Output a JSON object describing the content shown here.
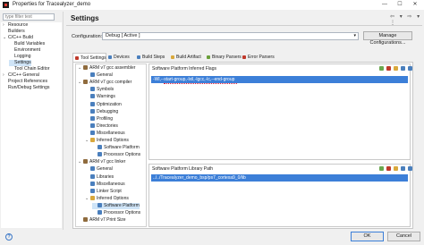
{
  "window": {
    "title": "Properties for Tracealyzer_demo",
    "controls": [
      "—",
      "☐",
      "✕"
    ]
  },
  "left": {
    "filter_placeholder": "type filter text",
    "tree": [
      {
        "label": "Resource",
        "twisty": "›",
        "depth": 0
      },
      {
        "label": "Builders",
        "twisty": "",
        "depth": 0
      },
      {
        "label": "C/C++ Build",
        "twisty": "⌄",
        "depth": 0
      },
      {
        "label": "Build Variables",
        "twisty": "",
        "depth": 1
      },
      {
        "label": "Environment",
        "twisty": "",
        "depth": 1
      },
      {
        "label": "Logging",
        "twisty": "",
        "depth": 1
      },
      {
        "label": "Settings",
        "twisty": "",
        "depth": 1,
        "selected": true
      },
      {
        "label": "Tool Chain Editor",
        "twisty": "",
        "depth": 1
      },
      {
        "label": "C/C++ General",
        "twisty": "›",
        "depth": 0
      },
      {
        "label": "Project References",
        "twisty": "",
        "depth": 0
      },
      {
        "label": "Run/Debug Settings",
        "twisty": "",
        "depth": 0
      }
    ]
  },
  "header": {
    "title": "Settings",
    "nav_icons": [
      "⇦",
      "▾",
      "⇨",
      "▾",
      "⋮"
    ]
  },
  "config": {
    "label": "Configuration:",
    "value": "Debug [ Active ]",
    "manage_label": "Manage Configurations..."
  },
  "tabs": [
    {
      "label": "Tool Settings",
      "active": true,
      "color": "#c0392b"
    },
    {
      "label": "Devices",
      "color": "#4a7fbd"
    },
    {
      "label": "Build Steps",
      "color": "#4a7fbd"
    },
    {
      "label": "Build Artifact",
      "color": "#d9a83c"
    },
    {
      "label": "Binary Parsers",
      "color": "#6a9f3a"
    },
    {
      "label": "Error Parsers",
      "color": "#c0392b"
    }
  ],
  "tool_tree": [
    {
      "label": "ARM v7 gcc assembler",
      "twisty": "⌄",
      "icon": "tool",
      "depth": 0
    },
    {
      "label": "General",
      "twisty": "",
      "icon": "opt",
      "depth": 1
    },
    {
      "label": "ARM v7 gcc compiler",
      "twisty": "⌄",
      "icon": "tool",
      "depth": 0
    },
    {
      "label": "Symbols",
      "twisty": "",
      "icon": "opt",
      "depth": 1
    },
    {
      "label": "Warnings",
      "twisty": "",
      "icon": "opt",
      "depth": 1
    },
    {
      "label": "Optimization",
      "twisty": "",
      "icon": "opt",
      "depth": 1
    },
    {
      "label": "Debugging",
      "twisty": "",
      "icon": "opt",
      "depth": 1
    },
    {
      "label": "Profiling",
      "twisty": "",
      "icon": "opt",
      "depth": 1
    },
    {
      "label": "Directories",
      "twisty": "",
      "icon": "opt",
      "depth": 1
    },
    {
      "label": "Miscellaneous",
      "twisty": "",
      "icon": "opt",
      "depth": 1
    },
    {
      "label": "Inferred Options",
      "twisty": "⌄",
      "icon": "folder",
      "depth": 1
    },
    {
      "label": "Software Platform",
      "twisty": "",
      "icon": "opt",
      "depth": 2
    },
    {
      "label": "Processor Options",
      "twisty": "",
      "icon": "opt",
      "depth": 2
    },
    {
      "label": "ARM v7 gcc linker",
      "twisty": "⌄",
      "icon": "tool",
      "depth": 0
    },
    {
      "label": "General",
      "twisty": "",
      "icon": "opt",
      "depth": 1
    },
    {
      "label": "Libraries",
      "twisty": "",
      "icon": "opt",
      "depth": 1
    },
    {
      "label": "Miscellaneous",
      "twisty": "",
      "icon": "opt",
      "depth": 1
    },
    {
      "label": "Linker Script",
      "twisty": "",
      "icon": "opt",
      "depth": 1
    },
    {
      "label": "Inferred Options",
      "twisty": "⌄",
      "icon": "folder",
      "depth": 1
    },
    {
      "label": "Software Platform",
      "twisty": "",
      "icon": "opt",
      "depth": 2,
      "selected": true
    },
    {
      "label": "Processor Options",
      "twisty": "",
      "icon": "opt",
      "depth": 2
    },
    {
      "label": "ARM v7 Print Size",
      "twisty": "",
      "icon": "tool",
      "depth": 0
    }
  ],
  "panels": {
    "flags": {
      "title": "Software Platform Inferred Flags",
      "value": "-Wl,--start-group,-lxil,-lgcc,-lc,--end-group"
    },
    "libpath": {
      "title": "Software Platform Library Path",
      "value": "../../Tracealyzer_demo_bsp/ps7_cortexa9_0/lib"
    }
  },
  "footer": {
    "help": "?",
    "ok_label": "OK",
    "cancel_label": "Cancel"
  },
  "colors": {
    "selection": "#3c7fd8",
    "tree_selection": "#cfe4f7"
  }
}
